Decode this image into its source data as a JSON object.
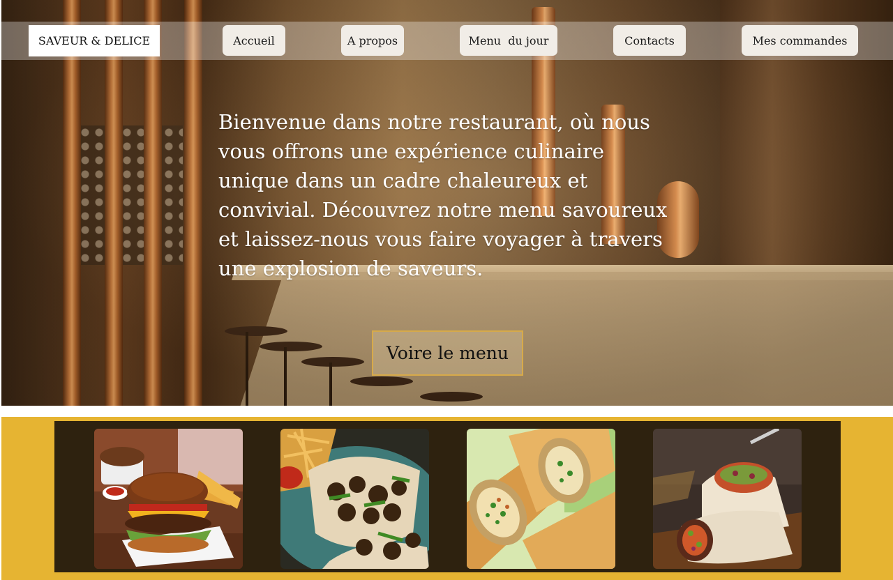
{
  "nav": {
    "brand": "SAVEUR & DELICE",
    "items": [
      "Accueil",
      "A propos",
      "Menu  du jour",
      "Contacts",
      "Mes commandes"
    ]
  },
  "hero": {
    "text": "Bienvenue dans notre restaurant, où nous vous offrons une expérience culinaire unique dans un cadre chaleureux et convivial. Découvrez notre menu savoureux et laissez-nous vous faire voyager à travers une explosion de saveurs.",
    "cta_label": "Voire le menu"
  },
  "gallery": {
    "items": [
      {
        "icon": "burger-fries-photo"
      },
      {
        "icon": "grilled-meat-tacos-photo"
      },
      {
        "icon": "spring-rolls-photo"
      },
      {
        "icon": "wrap-sandwich-photo"
      }
    ]
  },
  "colors": {
    "accent_yellow": "#e6b432",
    "strip_dark": "#2e220f",
    "cta_border": "#d7aa4a"
  }
}
